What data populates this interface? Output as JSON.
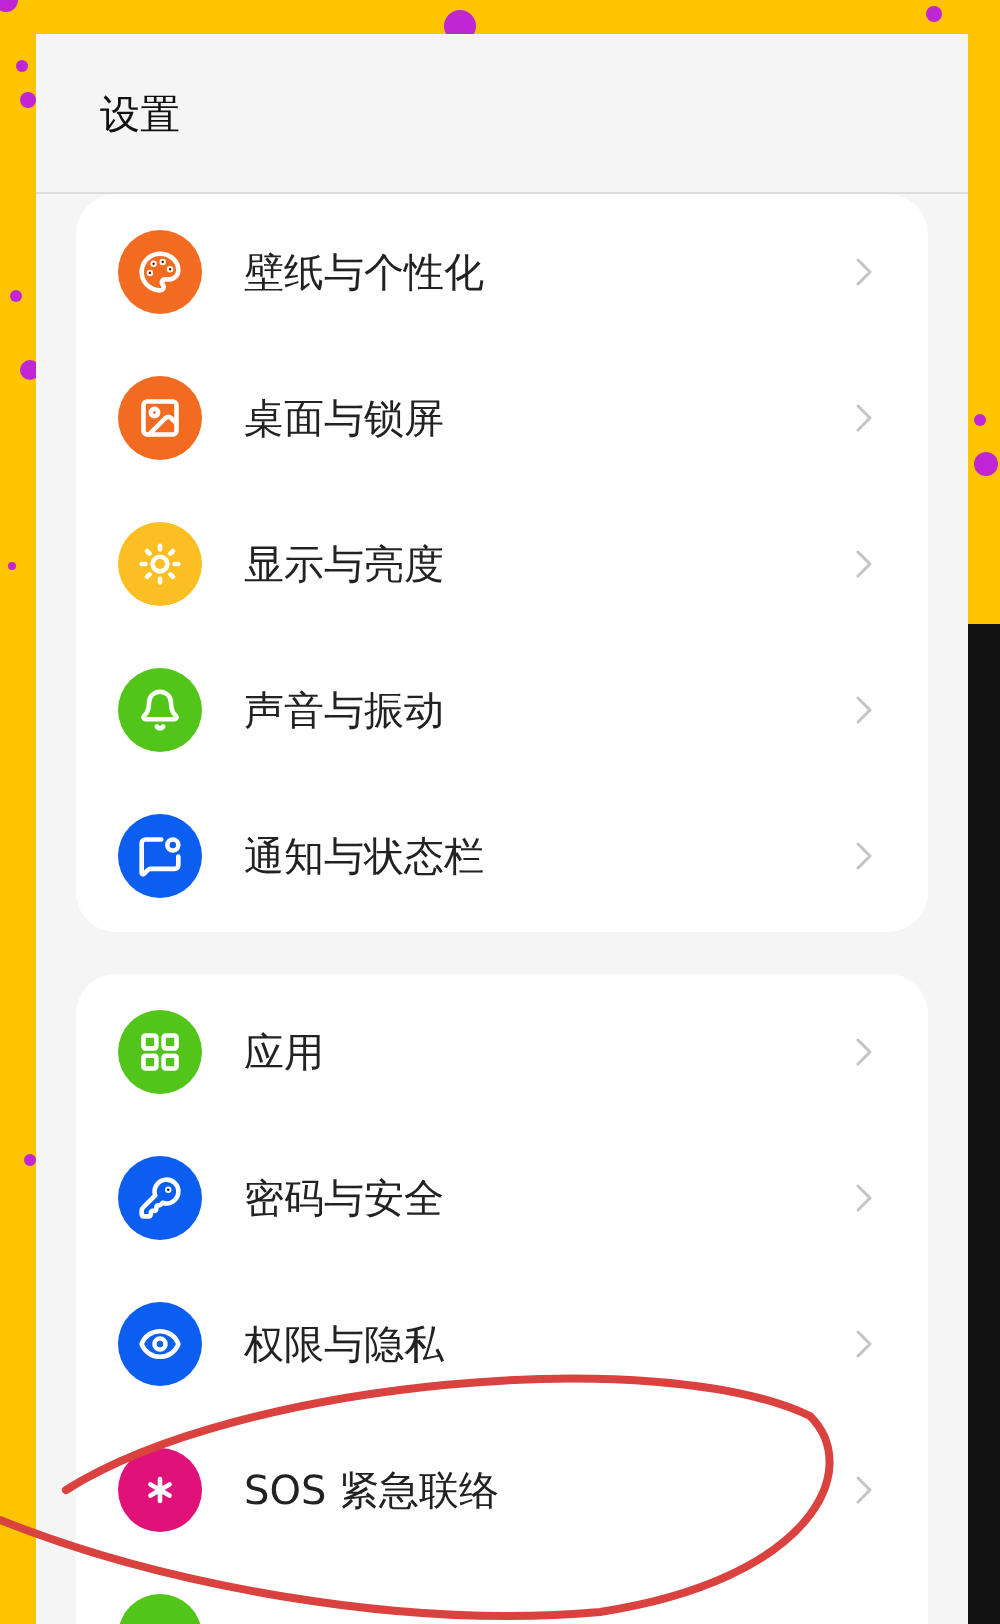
{
  "header": {
    "title": "设置"
  },
  "sections": [
    {
      "items": [
        {
          "label": "壁纸与个性化",
          "color": "#f26b21"
        },
        {
          "label": "桌面与锁屏",
          "color": "#f26b21"
        },
        {
          "label": "显示与亮度",
          "color": "#fbbf24"
        },
        {
          "label": "声音与振动",
          "color": "#52c41a"
        },
        {
          "label": "通知与状态栏",
          "color": "#0b5ef0"
        }
      ]
    },
    {
      "items": [
        {
          "label": "应用",
          "color": "#52c41a"
        },
        {
          "label": "密码与安全",
          "color": "#0b5ef0"
        },
        {
          "label": "权限与隐私",
          "color": "#0b5ef0"
        },
        {
          "label": "SOS 紧急联络",
          "color": "#e0127a"
        },
        {
          "color": "#52c41a"
        }
      ]
    }
  ]
}
